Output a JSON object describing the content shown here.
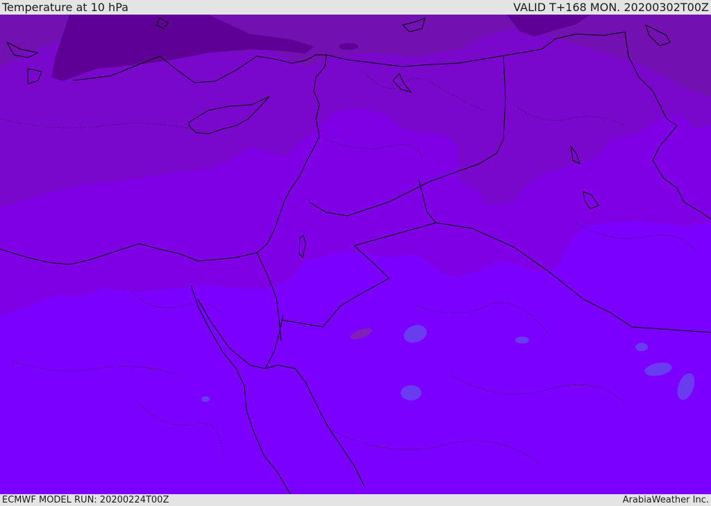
{
  "header": {
    "title": "Temperature at 10 hPa",
    "valid_time": "VALID T+168 MON. 20200302T00Z"
  },
  "footer": {
    "model_run": "ECMWF MODEL RUN: 20200224T00Z",
    "credit": "ArabiaWeather Inc."
  },
  "map": {
    "palette": {
      "band_darkest": "#5e0096",
      "band_dark": "#7210b2",
      "band_mid": "#7a08cc",
      "band_light": "#8000e6",
      "band_lightest": "#7b00ff",
      "blue_spot": "#6a3cf0",
      "coastline": "#000000"
    }
  }
}
